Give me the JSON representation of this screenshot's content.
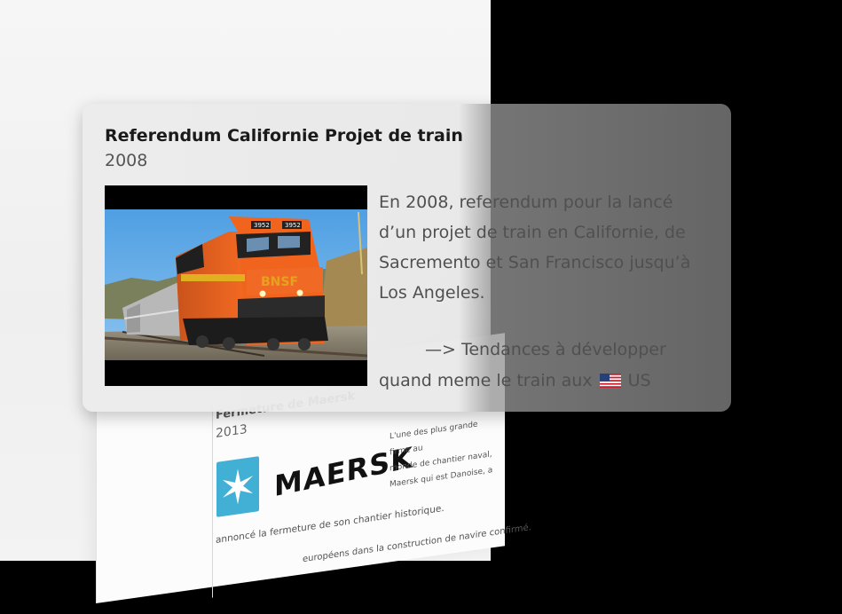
{
  "card": {
    "title": "Referendum Californie Projet de train",
    "year": "2008",
    "paragraph_lines": [
      "En 2008, referendum pour la lancé",
      "d’un projet de train en Californie, de",
      "Sacremento et San Francisco jusqu’à",
      "Los Angeles."
    ],
    "arrow_line": "—> Tendances à développer",
    "last_line_prefix": "quand meme le train aux",
    "last_line_suffix": "US",
    "flag_icon": "us-flag-icon",
    "image_icon": "train-locomotive-photo",
    "locomotive_numbers": [
      "3952",
      "3952"
    ]
  },
  "background_page": {
    "title": "Fermeture de Maersk",
    "year": "2013",
    "logo_word": "MAERSK",
    "logo_icon": "maersk-star-icon",
    "logo_color": "#42b0d5",
    "description_lines": [
      "L'une des plus grande firme au",
      "monde de chantier naval,",
      "Maersk qui est Danoise, a"
    ],
    "line_1": "annoncé la fermeture de son chantier historique.",
    "line_2": "européens dans la construction de navire confirmé."
  },
  "colors": {
    "locomotive_orange": "#f0641e",
    "sky_blue": "#5aa7e6",
    "card_text": "#505050"
  }
}
